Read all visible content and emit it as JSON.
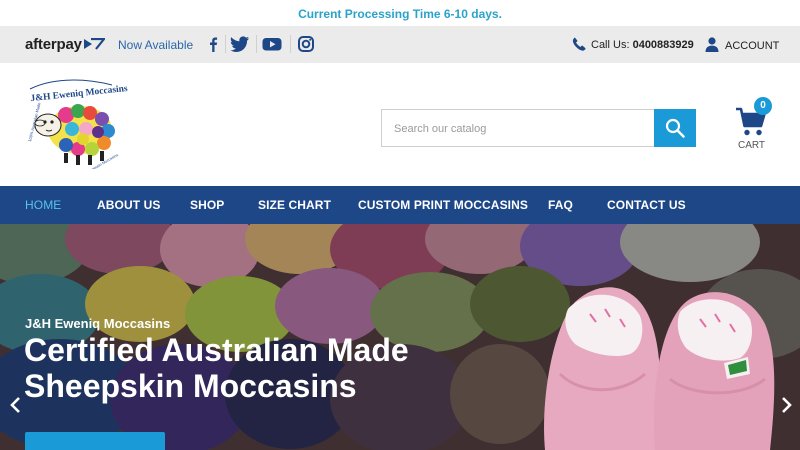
{
  "topbar": {
    "message": "Current Processing Time 6-10 days."
  },
  "utility": {
    "afterpay_brand": "afterpay",
    "now_available": "Now Available",
    "call_label": "Call Us:",
    "phone": "0400883929",
    "account": "ACCOUNT",
    "social_icons": [
      "facebook-icon",
      "twitter-icon",
      "youtube-icon",
      "instagram-icon"
    ]
  },
  "header": {
    "logo_name": "J&H Eweniq Moccasins",
    "search_placeholder": "Search our catalog",
    "cart_count": "0",
    "cart_label": "CART"
  },
  "nav": {
    "items": [
      "HOME",
      "ABOUT US",
      "SHOP",
      "SIZE CHART",
      "CUSTOM PRINT MOCCASINS",
      "FAQ",
      "CONTACT US"
    ],
    "active": "HOME"
  },
  "hero": {
    "subtitle": "J&H Eweniq Moccasins",
    "title": "Certified Australian Made Sheepskin Moccasins"
  },
  "colors": {
    "accent": "#1a9bd7",
    "nav_bg": "#1e4788",
    "topbar_text": "#2aa3c9",
    "utility_bg": "#ebebeb"
  }
}
